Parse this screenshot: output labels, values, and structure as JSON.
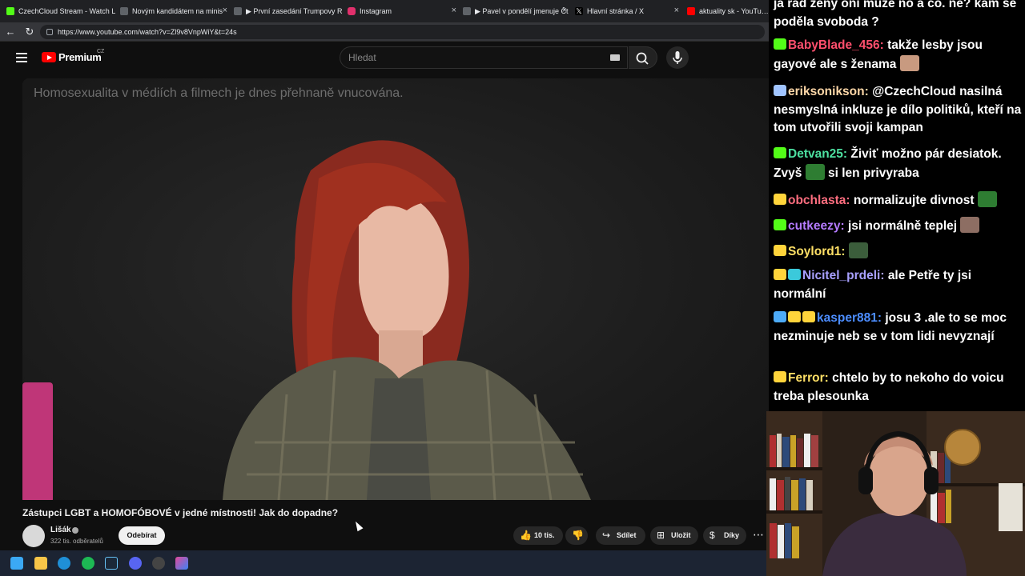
{
  "browser": {
    "tabs": [
      {
        "title": "CzechCloud Stream - Watch L",
        "favicon_color": "#53fc18"
      },
      {
        "title": "Novým kandidátem na minis",
        "favicon_color": "#9aa0a6"
      },
      {
        "title": "▶ První zasedání Trumpovy R",
        "favicon_color": "#9aa0a6"
      },
      {
        "title": "Instagram",
        "favicon_color": "#e1306c"
      },
      {
        "title": "▶ Pavel v pondělí jmenuje Čt",
        "favicon_color": "#9aa0a6"
      },
      {
        "title": "Hlavní stránka / X",
        "favicon_color": "#000000"
      },
      {
        "title": "aktuality sk - YouTube",
        "favicon_color": "#ff0000"
      }
    ],
    "url": "https://www.youtube.com/watch?v=Zl9v8VnpWiY&t=24s"
  },
  "youtube": {
    "logo_text": "Premium",
    "region": "CZ",
    "search_placeholder": "Hledat",
    "video": {
      "caption": "Homosexualita v médiích a filmech je dnes přehnaně vnucována.",
      "title": "Zástupci LGBT a HOMOFÓBOVÉ v jedné místnosti! Jak do dopadne?"
    },
    "channel": {
      "name": "Lišák",
      "subscribers": "322 tis. odběratelů"
    },
    "subscribe_label": "Odebírat",
    "actions": {
      "likes": "10 tis.",
      "share": "Sdílet",
      "save": "Uložit",
      "thanks": "Díky"
    }
  },
  "chat": {
    "messages": [
      {
        "user": "",
        "text": "ja rád ženy oni může no a co. ne? kam se poděla svoboda ?",
        "color": "#ffffff",
        "badges": []
      },
      {
        "user": "BabyBlade_456:",
        "text": "takže lesby jsou gayové ale s ženama",
        "color": "#ff4f6d",
        "badges": [
          "#53fc18"
        ],
        "emote": "#c89a80"
      },
      {
        "user": "eriksonikson:",
        "text": "@CzechCloud nasilná nesmyslná inkluze je dílo politiků, kteří na tom utvořili svoji kampan",
        "color": "#ffd8a8",
        "badges": [
          "#a0c4ff"
        ]
      },
      {
        "user": "Detvan25:",
        "text": "Živiť možno pár desiatok. Zvyš",
        "text2": "si len privyraba",
        "color": "#4de0a0",
        "badges": [
          "#53fc18"
        ],
        "emote_mid": "#2e7d32"
      },
      {
        "user": "obchlasta:",
        "text": "normalizujte divnost",
        "color": "#ff6e7f",
        "badges": [
          "#ffd43b"
        ],
        "emote": "#2e7d32"
      },
      {
        "user": "cutkeezy:",
        "text": "jsi normálně teplej",
        "color": "#b57bff",
        "badges": [
          "#53fc18"
        ],
        "emote": "#8d6e63"
      },
      {
        "user": "Soylord1:",
        "text": "",
        "color": "#ffe066",
        "badges": [
          "#ffd43b"
        ],
        "emote": "#3b5d3b"
      },
      {
        "user": "Nicitel_prdeli:",
        "text": "ale Petře ty jsi normální",
        "color": "#a8a0ff",
        "badges": [
          "#ffd43b",
          "#3bc9db"
        ]
      },
      {
        "user": "kasper881:",
        "text": "josu 3 .ale to se moc nezminuje neb se v tom lidi nevyznají",
        "color": "#4c8dff",
        "badges": [
          "#4dabf7",
          "#ffd43b",
          "#ffd43b"
        ]
      },
      {
        "user": "Ferror:",
        "text": "chtelo by to nekoho do voicu treba plesounka",
        "color": "#ffe066",
        "badges": [
          "#ffd43b"
        ]
      }
    ]
  }
}
